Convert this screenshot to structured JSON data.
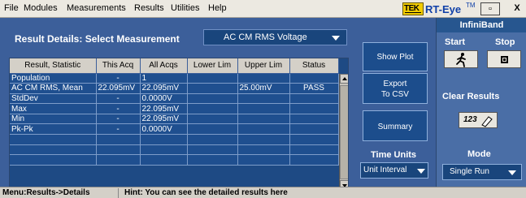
{
  "menu": [
    "File",
    "Modules",
    "Measurements",
    "Results",
    "Utilities",
    "Help"
  ],
  "brand": {
    "logo": "TEK",
    "name": "RT-Eye",
    "tm": "TM"
  },
  "window": {
    "minimize": "▫",
    "close": "X"
  },
  "panel": {
    "title": "Result Details: Select Measurement",
    "measurement": "AC CM RMS Voltage"
  },
  "table": {
    "headers": [
      "Result, Statistic",
      "This Acq",
      "All Acqs",
      "Lower Lim",
      "Upper Lim",
      "Status"
    ],
    "rows": [
      [
        "Population",
        "-",
        "1",
        "",
        "",
        ""
      ],
      [
        "AC CM RMS, Mean",
        "22.095mV",
        "22.095mV",
        "",
        "25.00mV",
        "PASS"
      ],
      [
        "StdDev",
        "-",
        "0.0000V",
        "",
        "",
        ""
      ],
      [
        "Max",
        "-",
        "22.095mV",
        "",
        "",
        ""
      ],
      [
        "Min",
        "-",
        "22.095mV",
        "",
        "",
        ""
      ],
      [
        "Pk-Pk",
        "-",
        "0.0000V",
        "",
        "",
        ""
      ],
      [
        "",
        "",
        "",
        "",
        "",
        ""
      ],
      [
        "",
        "",
        "",
        "",
        "",
        ""
      ],
      [
        "",
        "",
        "",
        "",
        "",
        ""
      ]
    ]
  },
  "buttons": {
    "show_plot": "Show Plot",
    "export_line1": "Export",
    "export_line2": "To CSV",
    "summary": "Summary"
  },
  "time_units": {
    "label": "Time Units",
    "value": "Unit Interval"
  },
  "side": {
    "title": "InfiniBand",
    "start": "Start",
    "stop": "Stop",
    "clear_results": "Clear Results",
    "clear_icon_text": "123",
    "mode_label": "Mode",
    "mode_value": "Single Run"
  },
  "status": {
    "menu_path": "Menu:Results->Details",
    "hint": "Hint: You can see the detailed results here"
  },
  "colors": {
    "panel_blue": "#3c5f9a",
    "cell_blue": "#1f4f8f",
    "side_blue": "#4a6ea6",
    "brand_blue": "#1040a8",
    "logo_yellow": "#f2cc00"
  }
}
